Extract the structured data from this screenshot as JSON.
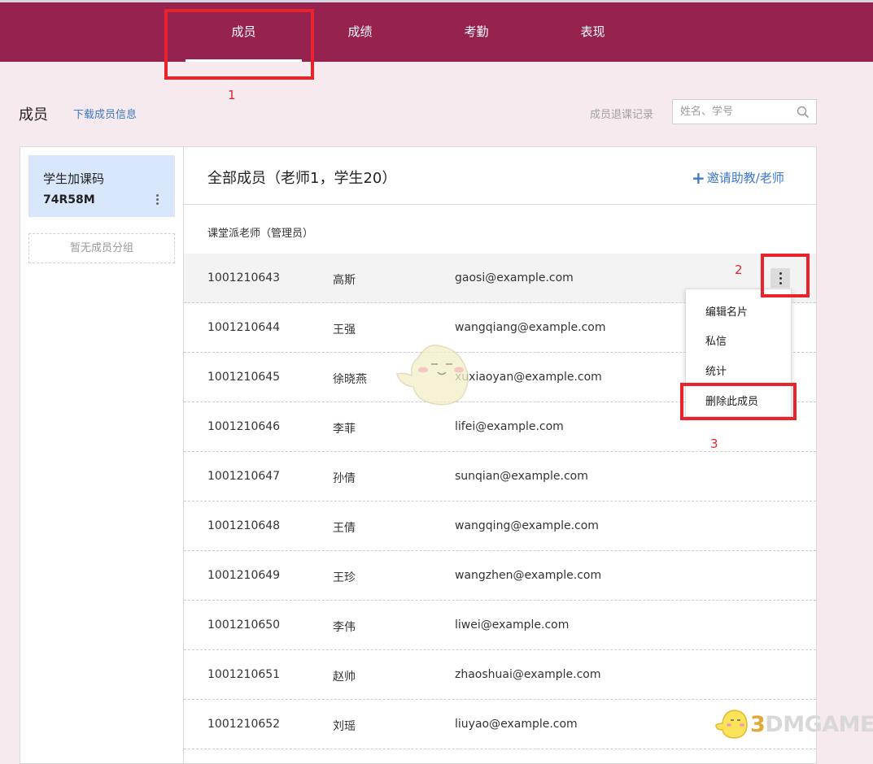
{
  "nav": {
    "tabs": [
      "成员",
      "成绩",
      "考勤",
      "表现"
    ],
    "active": "成员"
  },
  "annotations": [
    "1",
    "2",
    "3"
  ],
  "header": {
    "title": "成员",
    "download_link": "下载成员信息",
    "withdraw_link": "成员退课记录",
    "search_placeholder": "姓名、学号"
  },
  "sidebar": {
    "join_code_title": "学生加课码",
    "join_code": "74R58M",
    "no_group": "暂无成员分组"
  },
  "main": {
    "title": "全部成员（老师1，学生20）",
    "invite_button": "邀请助教/老师",
    "admin_label": "课堂派老师（管理员）"
  },
  "members": [
    {
      "id": "1001210643",
      "name": "高斯",
      "email": "gaosi@example.com"
    },
    {
      "id": "1001210644",
      "name": "王强",
      "email": "wangqiang@example.com"
    },
    {
      "id": "1001210645",
      "name": "徐晓燕",
      "email": "xuxiaoyan@example.com"
    },
    {
      "id": "1001210646",
      "name": "李菲",
      "email": "lifei@example.com"
    },
    {
      "id": "1001210647",
      "name": "孙倩",
      "email": "sunqian@example.com"
    },
    {
      "id": "1001210648",
      "name": "王倩",
      "email": "wangqing@example.com"
    },
    {
      "id": "1001210649",
      "name": "王珍",
      "email": "wangzhen@example.com"
    },
    {
      "id": "1001210650",
      "name": "李伟",
      "email": "liwei@example.com"
    },
    {
      "id": "1001210651",
      "name": "赵帅",
      "email": "zhaoshuai@example.com"
    },
    {
      "id": "1001210652",
      "name": "刘瑶",
      "email": "liuyao@example.com"
    }
  ],
  "context_menu": [
    "编辑名片",
    "私信",
    "统计",
    "删除此成员"
  ],
  "watermark": {
    "digit": "3",
    "text": "DMGAME"
  },
  "colors": {
    "nav_bg": "#96224f",
    "page_bg": "#f6eaee",
    "link": "#3c78c8",
    "highlight_box": "#e8232b",
    "join_code_card": "#d8e7fb"
  }
}
